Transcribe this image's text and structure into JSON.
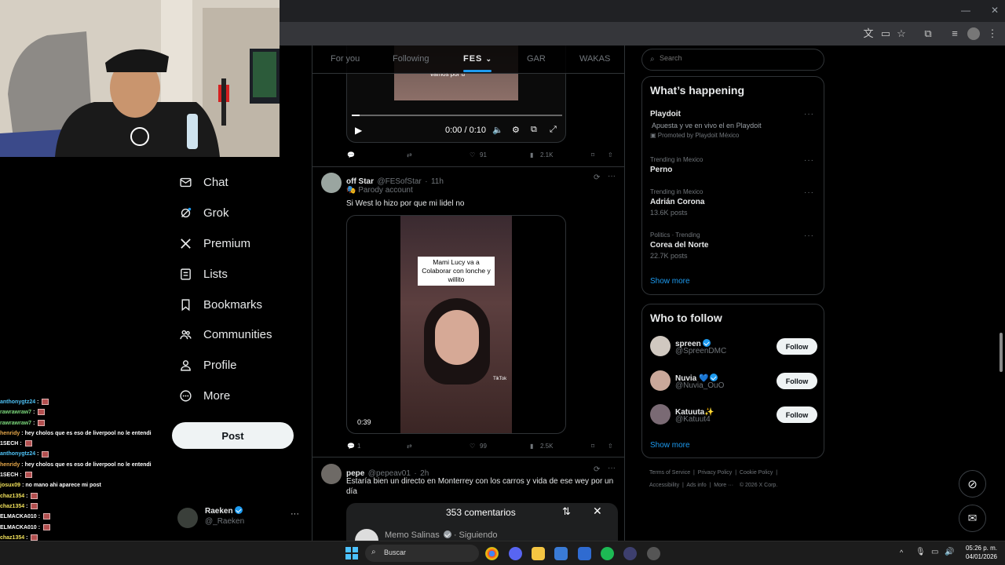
{
  "tabs": [
    {
      "label": "For you"
    },
    {
      "label": "Following"
    },
    {
      "label": "FES"
    },
    {
      "label": "GAR"
    },
    {
      "label": "WAKAS"
    }
  ],
  "nav": {
    "chat": "Chat",
    "grok": "Grok",
    "premium": "Premium",
    "lists": "Lists",
    "bookmarks": "Bookmarks",
    "communities": "Communities",
    "profile": "Profile",
    "more": "More",
    "post": "Post"
  },
  "account": {
    "name": "Raeken",
    "handle": "@_Raeken"
  },
  "chat_overlay": [
    {
      "user": "anthonygtz24",
      "msg": "",
      "color": "#4fc3f7"
    },
    {
      "user": "rawrawraw7",
      "msg": "",
      "color": "#7bd87b"
    },
    {
      "user": "rawrawraw7",
      "msg": "",
      "color": "#7bd87b"
    },
    {
      "user": "henridy",
      "msg": "hey cholos que es eso de liverpool no le entendi",
      "color": "#e8a94a"
    },
    {
      "user": "1SECH",
      "msg": "",
      "color": "#ffffff"
    },
    {
      "user": "anthonygtz24",
      "msg": "",
      "color": "#4fc3f7"
    },
    {
      "user": "henridy",
      "msg": "hey cholos que es eso de liverpool no le entendi",
      "color": "#e8a94a"
    },
    {
      "user": "1SECH",
      "msg": "",
      "color": "#ffffff"
    },
    {
      "user": "josux09",
      "msg": "no mano ahi aparece mi post",
      "color": "#f0e05a"
    },
    {
      "user": "chaz1354",
      "msg": "",
      "color": "#f0e05a"
    },
    {
      "user": "chaz1354",
      "msg": "",
      "color": "#f0e05a"
    },
    {
      "user": "ELMACKA010",
      "msg": "",
      "color": "#ffffff"
    },
    {
      "user": "ELMACKA010",
      "msg": "",
      "color": "#ffffff"
    },
    {
      "user": "chaz1354",
      "msg": "",
      "color": "#f0e05a"
    },
    {
      "user": "ELMACKA010",
      "msg": "",
      "color": "#ffffff"
    },
    {
      "user": "ELMACKA010",
      "msg": "",
      "color": "#ffffff"
    }
  ],
  "tweet1": {
    "video_caption": "vamos por u",
    "time": "0:00 / 0:10",
    "replies": "",
    "reposts": "",
    "likes": "91",
    "views": "2.1K"
  },
  "tweet2": {
    "name": "off Star",
    "handle": "@FESofStar",
    "time": "11h",
    "badge": "Parody account",
    "text": "Si West lo hizo por que mi lidel no",
    "overlay_text": "Mami Lucy va a Colaborar con lonche y willito",
    "tiktok_label": "TikTok",
    "duration": "0:39",
    "replies": "1",
    "likes": "99",
    "views": "2.5K"
  },
  "tweet3": {
    "name": "pepe",
    "handle": "@pepeav01",
    "time": "2h",
    "text": "Estaría bien un directo en Monterrey con los carros y vida de ese wey por un día",
    "comments_header": "353 comentarios",
    "comment_user": "Memo Salinas",
    "comment_status": "Siguiendo"
  },
  "search": {
    "placeholder": "Search"
  },
  "whats_happening": {
    "title": "What’s happening",
    "items": [
      {
        "meta": "",
        "title": "Playdoit",
        "sub": "Apuesta y ve en vivo el  en Playdoit",
        "promo": "Promoted by Playdoit México"
      },
      {
        "meta": "Trending in Mexico",
        "title": "Perno",
        "sub": ""
      },
      {
        "meta": "Trending in Mexico",
        "title": "Adrián Corona",
        "sub": "13.6K posts"
      },
      {
        "meta": "Politics · Trending",
        "title": "Corea del Norte",
        "sub": "22.7K posts"
      }
    ],
    "show_more": "Show more"
  },
  "who_to_follow": {
    "title": "Who to follow",
    "users": [
      {
        "name": "spreen",
        "handle": "@SpreenDMC"
      },
      {
        "name": "Nuvia 💙",
        "handle": "@Nuvia_OuO"
      },
      {
        "name": "Katuuta✨",
        "handle": "@Katuut4"
      }
    ],
    "follow_label": "Follow",
    "show_more": "Show more"
  },
  "footer": {
    "terms": "Terms of Service",
    "privacy": "Privacy Policy",
    "cookie": "Cookie Policy",
    "accessibility": "Accessibility",
    "ads": "Ads info",
    "more": "More ···",
    "copyright": "© 2026 X Corp."
  },
  "taskbar": {
    "search_placeholder": "Buscar",
    "time": "05:26 p. m.",
    "date": "04/01/2026"
  },
  "colors": {
    "accent": "#1d9bf0",
    "background": "#000000",
    "border": "#2f3336"
  }
}
